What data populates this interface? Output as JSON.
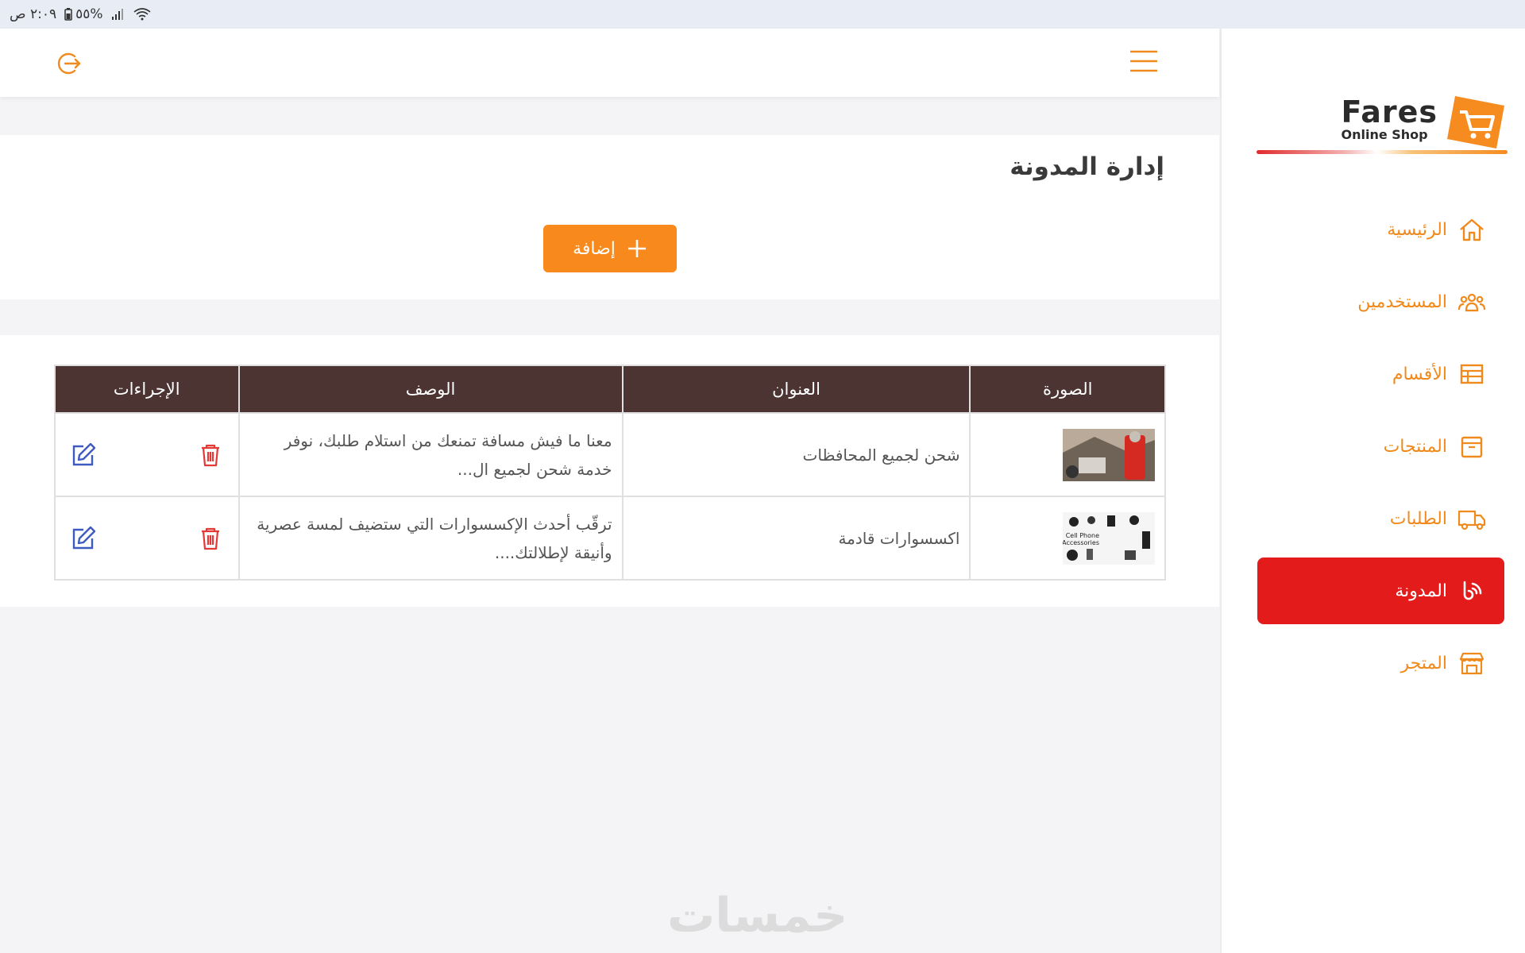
{
  "status_bar": {
    "time": "٢:٠٩ ص",
    "battery": "٥٥%"
  },
  "brand": {
    "name": "Fares",
    "tagline": "Online Shop"
  },
  "sidebar": {
    "items": [
      {
        "label": "الرئيسية",
        "icon": "home-icon"
      },
      {
        "label": "المستخدمين",
        "icon": "users-icon"
      },
      {
        "label": "الأقسام",
        "icon": "categories-icon"
      },
      {
        "label": "المنتجات",
        "icon": "box-icon"
      },
      {
        "label": "الطلبات",
        "icon": "truck-icon"
      },
      {
        "label": "المدونة",
        "icon": "blog-icon",
        "active": true
      },
      {
        "label": "المتجر",
        "icon": "store-icon"
      }
    ]
  },
  "page": {
    "title": "إدارة المدونة",
    "add_label": "إضافة"
  },
  "table": {
    "headers": {
      "image": "الصورة",
      "title": "العنوان",
      "description": "الوصف",
      "actions": "الإجراءات"
    },
    "rows": [
      {
        "title": "شحن لجميع المحافظات",
        "description": "معنا ما فيش مسافة تمنعك من استلام طلبك، نوفر خدمة شحن لجميع ال...",
        "thumb": "delivery-photo"
      },
      {
        "title": "اكسسوارات قادمة",
        "description": "ترقّب أحدث الإكسسوارات التي ستضيف لمسة عصرية وأنيقة لإطلالتك....",
        "thumb": "accessories-photo"
      }
    ]
  },
  "watermark": "خمسات",
  "colors": {
    "accent": "#f88a1d",
    "active": "#e31b1b",
    "table_header": "#4c3433",
    "edit": "#3f5bbf",
    "delete": "#e53935"
  }
}
